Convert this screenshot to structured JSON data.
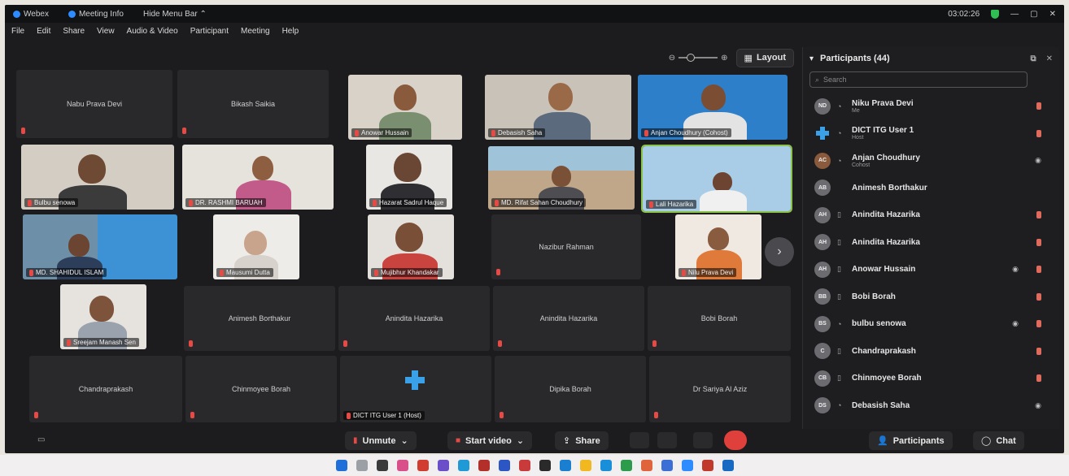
{
  "titlebar": {
    "app": "Webex",
    "meeting_info": "Meeting Info",
    "hide_menu": "Hide Menu Bar ⌃",
    "time": "03:02:26"
  },
  "menu": [
    "File",
    "Edit",
    "Share",
    "View",
    "Audio & Video",
    "Participant",
    "Meeting",
    "Help"
  ],
  "grid_toolbar": {
    "layout_label": "Layout"
  },
  "tiles": [
    {
      "name": "Nabu Prava Devi",
      "video": false
    },
    {
      "name": "Bikash Saikia",
      "video": false
    },
    {
      "name": "Anowar Hussain",
      "video": true
    },
    {
      "name": "Debasish Saha",
      "video": true
    },
    {
      "name": "Anjan Choudhury (Cohost)",
      "video": true
    },
    {
      "name": "Bulbu senowa",
      "video": true
    },
    {
      "name": "DR. RASHMI BARUAH",
      "video": true
    },
    {
      "name": "Hazarat Sadrul Haque",
      "video": true
    },
    {
      "name": "MD. Rifat Sahan Choudhury",
      "video": true
    },
    {
      "name": "Lali Hazarika",
      "video": true
    },
    {
      "name": "MD. SHAHIDUL ISLAM",
      "video": true
    },
    {
      "name": "Mausumi Dutta",
      "video": true
    },
    {
      "name": "Mujibhur Khandakar",
      "video": true
    },
    {
      "name": "Nazibur Rahman",
      "video": false
    },
    {
      "name": "Nilu Prava Devi",
      "video": true
    },
    {
      "name": "Sreejam Manash Sen",
      "video": true
    },
    {
      "name": "Animesh Borthakur",
      "video": false
    },
    {
      "name": "Anindita Hazarika",
      "video": false
    },
    {
      "name": "Anindita Hazarika",
      "video": false
    },
    {
      "name": "Bobi Borah",
      "video": false
    },
    {
      "name": "Chandraprakash",
      "video": false
    },
    {
      "name": "Chinmoyee Borah",
      "video": false
    },
    {
      "name": "DICT ITG User 1 (Host)",
      "video": false
    },
    {
      "name": "Dipika Borah",
      "video": false
    },
    {
      "name": "Dr Sariya Al Aziz",
      "video": false
    }
  ],
  "panel": {
    "title": "Participants (44)",
    "search_placeholder": "Search",
    "participants": [
      {
        "initials": "ND",
        "name": "Niku Prava Devi",
        "sub": "Me"
      },
      {
        "initials": "",
        "name": "DICT ITG User 1",
        "sub": "Host"
      },
      {
        "initials": "AC",
        "name": "Anjan Choudhury",
        "sub": "Cohost"
      },
      {
        "initials": "AB",
        "name": "Animesh Borthakur",
        "sub": ""
      },
      {
        "initials": "AH",
        "name": "Anindita Hazarika",
        "sub": ""
      },
      {
        "initials": "AH",
        "name": "Anindita Hazarika",
        "sub": ""
      },
      {
        "initials": "AH",
        "name": "Anowar Hussain",
        "sub": ""
      },
      {
        "initials": "BB",
        "name": "Bobi Borah",
        "sub": ""
      },
      {
        "initials": "BS",
        "name": "bulbu senowa",
        "sub": ""
      },
      {
        "initials": "C",
        "name": "Chandraprakash",
        "sub": ""
      },
      {
        "initials": "CB",
        "name": "Chinmoyee Borah",
        "sub": ""
      },
      {
        "initials": "DS",
        "name": "Debasish Saha",
        "sub": ""
      }
    ]
  },
  "bottom": {
    "unmute": "Unmute",
    "start_video": "Start video",
    "share": "Share",
    "participants": "Participants",
    "chat": "Chat"
  },
  "colors": {
    "accent": "#2d8cff",
    "end_call": "#e0403b",
    "mute": "#e74a45",
    "active_speaker": "#8bc34a"
  }
}
